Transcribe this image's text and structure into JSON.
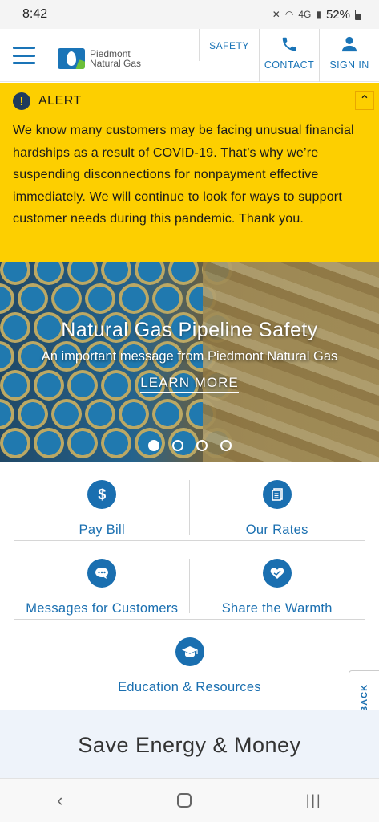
{
  "status": {
    "time": "8:42",
    "battery": "52%",
    "network": "4G"
  },
  "header": {
    "logo_line1": "Piedmont",
    "logo_line2": "Natural Gas",
    "safety_label": "SAFETY",
    "contact_label": "CONTACT",
    "signin_label": "SIGN IN"
  },
  "alert": {
    "title": "ALERT",
    "body": "We know many customers may be facing unusual financial hardships as a result of COVID-19. That’s why we’re suspending disconnections for nonpayment effective immediately. We will continue to look for ways to support customer needs during this pandemic. Thank you."
  },
  "hero": {
    "title": "Natural Gas Pipeline Safety",
    "subtitle": "An important message from Piedmont Natural Gas",
    "link": "LEARN MORE",
    "slide_count": 4,
    "active_slide": 1
  },
  "quick_links": [
    {
      "label": "Pay Bill",
      "icon": "dollar-icon"
    },
    {
      "label": "Our Rates",
      "icon": "document-icon"
    },
    {
      "label": "Messages for Customers",
      "icon": "chat-icon"
    },
    {
      "label": "Share the Warmth",
      "icon": "heart-hands-icon"
    },
    {
      "label": "Education & Resources",
      "icon": "graduation-cap-icon"
    }
  ],
  "feedback": {
    "label": "FEEDBACK"
  },
  "save_section": {
    "title": "Save Energy & Money"
  },
  "colors": {
    "brand_blue": "#1a6fb0",
    "alert_yellow": "#fdcf00",
    "save_bg": "#eef3fa"
  }
}
